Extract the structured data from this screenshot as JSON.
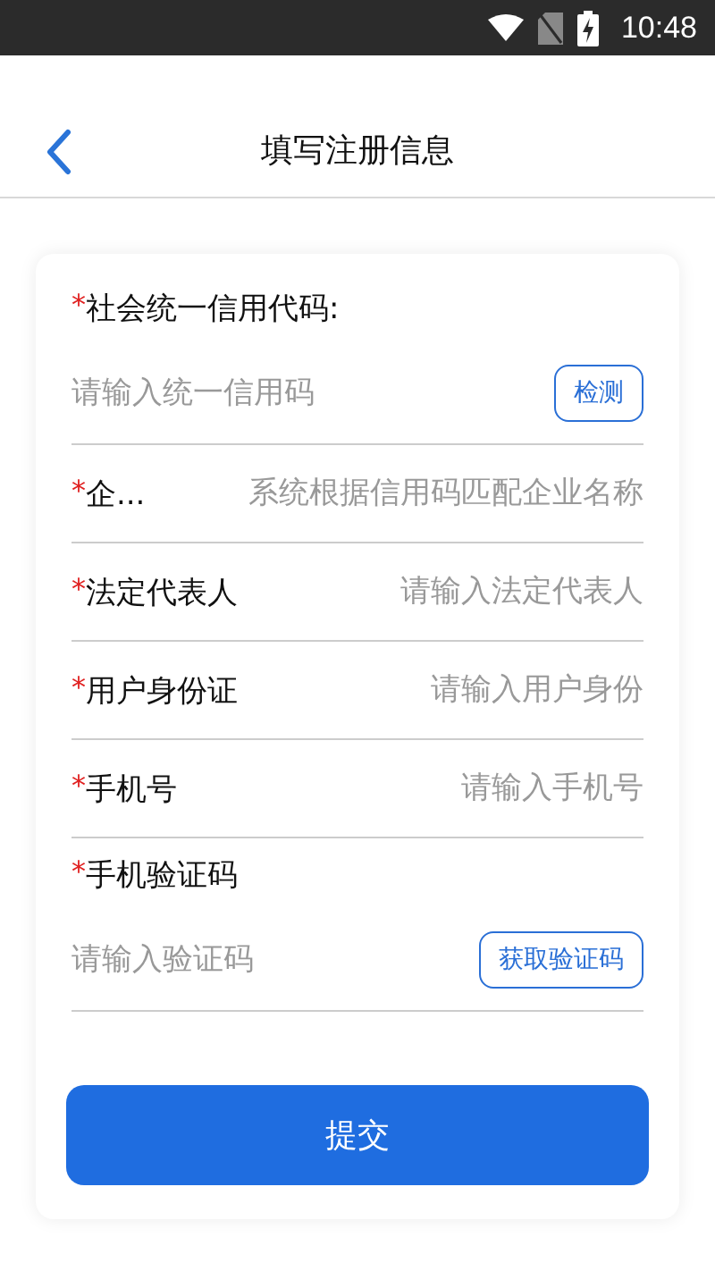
{
  "status_bar": {
    "time": "10:48"
  },
  "header": {
    "title": "填写注册信息"
  },
  "fields": [
    {
      "kind": "stacked",
      "mark": "*",
      "label": "社会统一信用代码:",
      "placeholder": "请输入统一信用码",
      "button": "检测"
    },
    {
      "kind": "inline",
      "mark": "*",
      "label": "企...",
      "placeholder": "系统根据信用码匹配企业名称"
    },
    {
      "kind": "inline",
      "mark": "*",
      "label": "法定代表人",
      "placeholder": "请输入法定代表人"
    },
    {
      "kind": "inline",
      "mark": "*",
      "label": "用户身份证",
      "placeholder": "请输入用户身份"
    },
    {
      "kind": "inline",
      "mark": "*",
      "label": "手机号",
      "placeholder": "请输入手机号"
    },
    {
      "kind": "stacked",
      "mark": "*",
      "label": "手机验证码",
      "placeholder": "请输入验证码",
      "button": "获取验证码"
    }
  ],
  "submit": "提交"
}
